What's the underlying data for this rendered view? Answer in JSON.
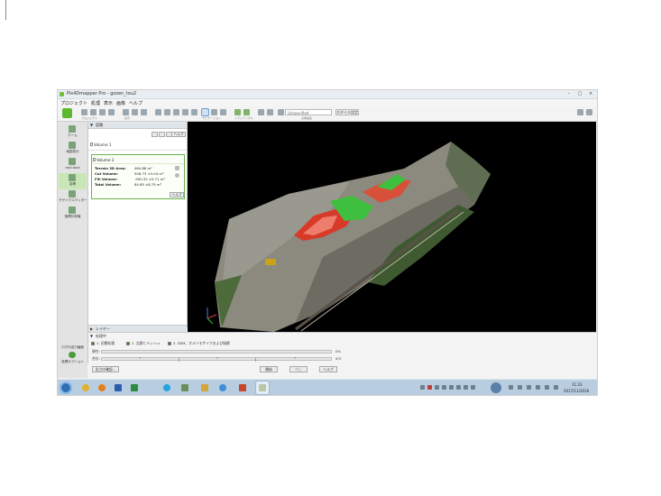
{
  "window": {
    "title": "Pix4Dmapper Pro - gozen_tou2",
    "controls": [
      "–",
      "□",
      "×"
    ]
  },
  "menu": [
    "プロジェクト",
    "処理",
    "表示",
    "画像",
    "ヘルプ"
  ],
  "toolbar": {
    "view_select": "Unspecified",
    "scale_button": "スタイル設定",
    "groups": [
      "プロジェクト",
      "表示",
      "ナビゲーション",
      "トライアングル",
      "点群編集"
    ]
  },
  "sidebar": {
    "items": [
      {
        "label": "ホーム",
        "icon": "home-icon"
      },
      {
        "label": "地図表示",
        "icon": "map-icon"
      },
      {
        "label": "rayCloud",
        "icon": "raycloud-icon"
      },
      {
        "label": "容積",
        "icon": "volume-icon"
      },
      {
        "label": "モザイクエディター",
        "icon": "mosaic-icon"
      },
      {
        "label": "指標計算機",
        "icon": "index-icon"
      }
    ],
    "processing_label": "処理中",
    "log_label": "ログの出力画面",
    "options_label": "処理オプション"
  },
  "panel": {
    "title": "容積",
    "help": "ヘルプ",
    "volume1": "Volume 1",
    "volume2": {
      "title": "Volume 2",
      "rows": [
        {
          "label": "Terrain 3D Area:",
          "value": "464.88 m²"
        },
        {
          "label": "Cut Volume:",
          "value": "506.73 ±3.04 m³"
        },
        {
          "label": "Fill Volume:",
          "value": "-590.32 ±5.71 m³"
        },
        {
          "label": "Total Volume:",
          "value": "84.65 ±8.75 m³"
        }
      ],
      "help": "ヘルプ"
    },
    "layers": "レイヤー"
  },
  "processing": {
    "title": "処理中",
    "checks": [
      {
        "label": "1. 初期処理",
        "checked": true
      },
      {
        "label": "2. 点群とメッシュ",
        "checked": true
      },
      {
        "label": "3. DSM、オルソモザイクおよび指標",
        "checked": true
      }
    ],
    "current_label": "現在:",
    "current_value": "0%",
    "total_label": "合計:",
    "total_value": "0/3",
    "total_ticks": [
      "1",
      "2",
      "3"
    ],
    "buttons": [
      "出力の確認...",
      "開始",
      "中止",
      "ヘルプ"
    ]
  },
  "taskbar": {
    "apps": [
      "start-orb",
      "chrome",
      "media-player",
      "word",
      "excel",
      "skype",
      "windows-explorer",
      "outlook",
      "internet-explorer",
      "powerpoint",
      "pix4d"
    ],
    "time": "11:23",
    "date": "2017/11/2016"
  },
  "colors": {
    "brand_green": "#5db82d",
    "viewport_bg": "#000000",
    "cut_red": "#d83a2a",
    "fill_green": "#3fbf3f",
    "taskbar": "#b8cde0"
  }
}
